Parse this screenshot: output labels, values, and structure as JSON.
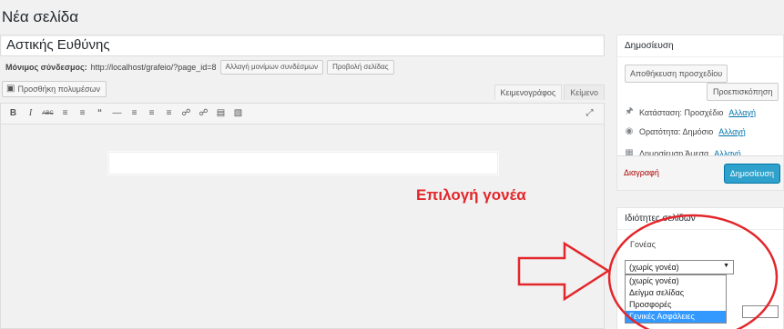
{
  "page": {
    "title": "Νέα σελίδα"
  },
  "post": {
    "title": "Αστικής Ευθύνης"
  },
  "permalink": {
    "label": "Μόνιμος σύνδεσμος:",
    "url": "http://localhost/grafeio/?page_id=8",
    "change_button": "Αλλαγή μονίμων συνδέσμων",
    "view_button": "Προβολή σελίδας"
  },
  "media": {
    "button_label": "Προσθήκη πολυμέσων",
    "icon": "media-icon"
  },
  "editor": {
    "tabs": [
      "Κειμενογράφος",
      "Κείμενο"
    ],
    "active_tab": "Κειμενογράφος",
    "toolbar": [
      "bold-icon",
      "italic-icon",
      "strikethrough-icon",
      "bullet-list-icon",
      "numbered-list-icon",
      "blockquote-icon",
      "horizontal-line-icon",
      "align-left-icon",
      "align-center-icon",
      "align-right-icon",
      "link-icon",
      "unlink-icon",
      "read-more-icon",
      "toolbar-toggle-icon",
      "fullscreen-icon"
    ]
  },
  "publish_box": {
    "title": "Δημοσίευση",
    "save_draft": "Αποθήκευση προσχεδίου",
    "preview": "Προεπισκόπηση",
    "status_label": "Κατάσταση: Προσχέδιο",
    "status_link": "Αλλαγή",
    "visibility_label": "Ορατότητα: Δημόσιο",
    "visibility_link": "Αλλαγή",
    "schedule_label": "Δημοσίευση Άμεσα",
    "schedule_link": "Αλλαγή",
    "delete": "Διαγραφή",
    "publish": "Δημοσίευση"
  },
  "attributes_box": {
    "title": "Ιδιότητες σελίδων",
    "parent_label": "Γονέας",
    "parent_selected": "(χωρίς γονέα)",
    "parent_options": [
      "(χωρίς γονέα)",
      "Δείγμα σελίδας",
      "Προσφορές",
      "Γενικές Ασφάλειες"
    ],
    "highlighted_option_index": 3
  },
  "annotation": {
    "text": "Επιλογή γονέα",
    "color": "#e3262b"
  }
}
